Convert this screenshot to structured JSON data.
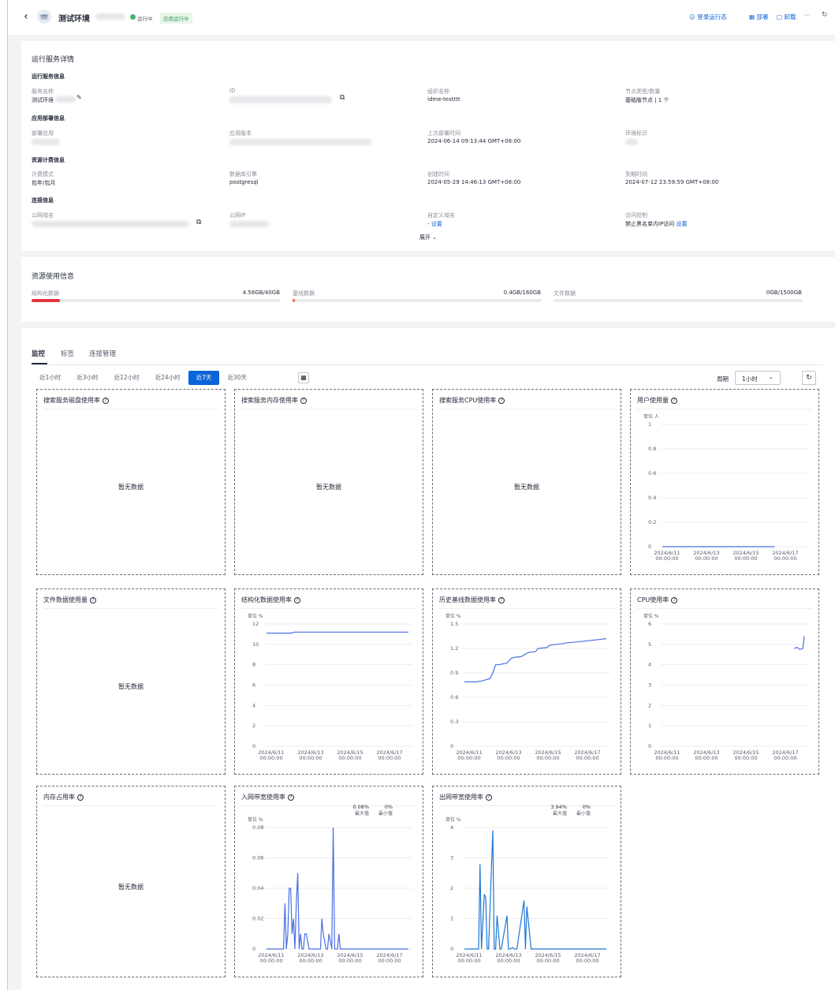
{
  "header": {
    "title": "测试环境",
    "status": "运行中",
    "app_badge": "应用运行中",
    "actions": {
      "login": "登录运行态",
      "deploy": "部署",
      "uninstall": "卸载",
      "more": "···"
    }
  },
  "details": {
    "title": "运行服务详情",
    "sections": {
      "runtime": "运行服务信息",
      "deploy": "应用部署信息",
      "billing": "资源计费信息",
      "connect": "连接信息"
    },
    "fields": {
      "service_name": {
        "label": "服务名称",
        "value": "测试环境"
      },
      "id": {
        "label": "ID"
      },
      "org": {
        "label": "组织名称",
        "value": "idme-testttt"
      },
      "node": {
        "label": "节点类型/数量",
        "value": "基础版节点 | 1 个"
      },
      "app": {
        "label": "部署应用"
      },
      "app_version": {
        "label": "应用版本"
      },
      "last_deploy": {
        "label": "上次部署时间",
        "value": "2024-06-14 09:13:44 GMT+08:00"
      },
      "env": {
        "label": "环境标识"
      },
      "billing_mode": {
        "label": "计费模式",
        "value": "包年/包月"
      },
      "db_engine": {
        "label": "数据库引擎",
        "value": "postgresql"
      },
      "created": {
        "label": "创建时间",
        "value": "2024-05-29 14:46:13 GMT+08:00"
      },
      "expires": {
        "label": "到期时间",
        "value": "2024-07-12 23:59:59 GMT+08:00"
      },
      "domain": {
        "label": "公网域名"
      },
      "ip": {
        "label": "公网IP"
      },
      "custom_domain": {
        "label": "自定义域名",
        "value": "- ",
        "link": "设置"
      },
      "access": {
        "label": "访问控制",
        "value": "禁止黑名单内IP访问",
        "link": "设置"
      }
    },
    "expand": "展开"
  },
  "usage": {
    "title": "资源使用信息",
    "items": [
      {
        "label": "结构化数据",
        "value": "4.56GB/40GB",
        "ratio": 0.114,
        "color": "#e5343d"
      },
      {
        "label": "基线数据",
        "value": "0.4GB/160GB",
        "ratio": 0.0025,
        "color": "#f56c2d"
      },
      {
        "label": "文件数据",
        "value": "0GB/1500GB",
        "ratio": 0,
        "color": "#0b64d9"
      }
    ]
  },
  "tabs": [
    "监控",
    "标签",
    "连接管理"
  ],
  "ranges": [
    "近1小时",
    "近3小时",
    "近12小时",
    "近24小时",
    "近7天",
    "近30天"
  ],
  "period": {
    "label": "周期",
    "value": "1小时"
  },
  "nodata": "暂无数据",
  "x_ticks": [
    "2024/6/11",
    "2024/6/13",
    "2024/6/15",
    "2024/6/17"
  ],
  "x_time": "00:00:00",
  "unit_people": "单位 人",
  "unit_pct": "单位 %",
  "max_label": "最大值",
  "min_label": "最小值",
  "chart_data": [
    {
      "title": "搜索服务磁盘使用率",
      "type": "line",
      "empty": true
    },
    {
      "title": "搜索服务内存使用率",
      "type": "line",
      "empty": true
    },
    {
      "title": "搜索服务CPU使用率",
      "type": "line",
      "empty": true
    },
    {
      "title": "用户使用量",
      "type": "line",
      "yticks": [
        "1",
        "0.8",
        "0.6",
        "0.4",
        "0.2",
        "0"
      ],
      "ylim": [
        0,
        1
      ],
      "series": [
        {
          "x": [
            0,
            0.9
          ],
          "y": [
            0,
            0
          ]
        }
      ]
    },
    {
      "title": "文件数据使用量",
      "type": "line",
      "empty": true
    },
    {
      "title": "结构化数据使用率",
      "type": "line",
      "yticks": [
        "12",
        "10",
        "8",
        "6",
        "4",
        "2",
        "0"
      ],
      "ylim": [
        0,
        12
      ],
      "series": [
        {
          "x": [
            0,
            0.17,
            0.2,
            1
          ],
          "y": [
            11.1,
            11.1,
            11.2,
            11.2
          ]
        }
      ]
    },
    {
      "title": "历史基线数据使用率",
      "type": "line",
      "yticks": [
        "1.5",
        "1.2",
        "0.9",
        "0.6",
        "0.3",
        "0"
      ],
      "ylim": [
        0,
        1.5
      ],
      "series": [
        {
          "x": [
            0,
            0.08,
            0.12,
            0.18,
            0.2,
            0.22,
            0.24,
            0.3,
            0.33,
            0.35,
            0.4,
            0.45,
            0.5,
            0.52,
            0.58,
            0.6,
            0.65,
            0.7,
            0.72,
            0.8,
            0.9,
            1.0
          ],
          "y": [
            0.79,
            0.79,
            0.8,
            0.83,
            0.9,
            1.0,
            1.0,
            1.02,
            1.08,
            1.09,
            1.1,
            1.15,
            1.16,
            1.2,
            1.21,
            1.24,
            1.25,
            1.26,
            1.27,
            1.28,
            1.3,
            1.32
          ]
        }
      ]
    },
    {
      "title": "CPU使用率",
      "type": "line",
      "yticks": [
        "6",
        "5",
        "4",
        "3",
        "2",
        "1",
        "0"
      ],
      "ylim": [
        0,
        6
      ],
      "series": [
        {
          "x": [
            0.93,
            0.95,
            0.97,
            0.99,
            1.0
          ],
          "y": [
            4.8,
            4.85,
            4.75,
            4.8,
            5.4
          ]
        }
      ]
    },
    {
      "title": "内存占用率",
      "type": "line",
      "empty": true
    },
    {
      "title": "入网带宽使用率",
      "type": "line",
      "max": "0.08%",
      "min": "0%",
      "yticks": [
        "0.08",
        "0.06",
        "0.04",
        "0.02",
        "0"
      ],
      "ylim": [
        0,
        0.08
      ],
      "series": [
        {
          "x": [
            0,
            0.12,
            0.13,
            0.14,
            0.15,
            0.16,
            0.17,
            0.18,
            0.19,
            0.2,
            0.21,
            0.22,
            0.23,
            0.24,
            0.25,
            0.26,
            0.27,
            0.28,
            0.3,
            0.31,
            0.32,
            0.38,
            0.39,
            0.4,
            0.42,
            0.43,
            0.44,
            0.46,
            0.47,
            0.48,
            0.5,
            0.51,
            0.52,
            0.55,
            0.6,
            0.7,
            1.0
          ],
          "y": [
            0,
            0,
            0.03,
            0,
            0.01,
            0.04,
            0.04,
            0.01,
            0.02,
            0,
            0.03,
            0.05,
            0,
            0.01,
            0,
            0,
            0.01,
            0.01,
            0,
            0,
            0,
            0,
            0.02,
            0.01,
            0,
            0,
            0.01,
            0,
            0.08,
            0,
            0,
            0.01,
            0,
            0,
            0,
            0,
            0
          ]
        }
      ]
    },
    {
      "title": "出网带宽使用率",
      "type": "line",
      "max": "3.94%",
      "min": "0%",
      "yticks": [
        "4",
        "3",
        "2",
        "1",
        "0"
      ],
      "ylim": [
        0,
        4
      ],
      "series": [
        {
          "x": [
            0,
            0.1,
            0.11,
            0.12,
            0.14,
            0.15,
            0.16,
            0.17,
            0.2,
            0.21,
            0.22,
            0.23,
            0.25,
            0.26,
            0.3,
            0.31,
            0.32,
            0.34,
            0.35,
            0.36,
            0.37,
            0.42,
            0.43,
            0.44,
            0.47,
            0.48,
            0.49,
            1.0
          ],
          "y": [
            0,
            0,
            2.8,
            0,
            1.8,
            1.7,
            0,
            0,
            3.9,
            0,
            0,
            1.1,
            0,
            0,
            1.1,
            0,
            0,
            0.05,
            0,
            0,
            0,
            1.6,
            0,
            1.4,
            0,
            0,
            0,
            0
          ]
        }
      ]
    }
  ]
}
